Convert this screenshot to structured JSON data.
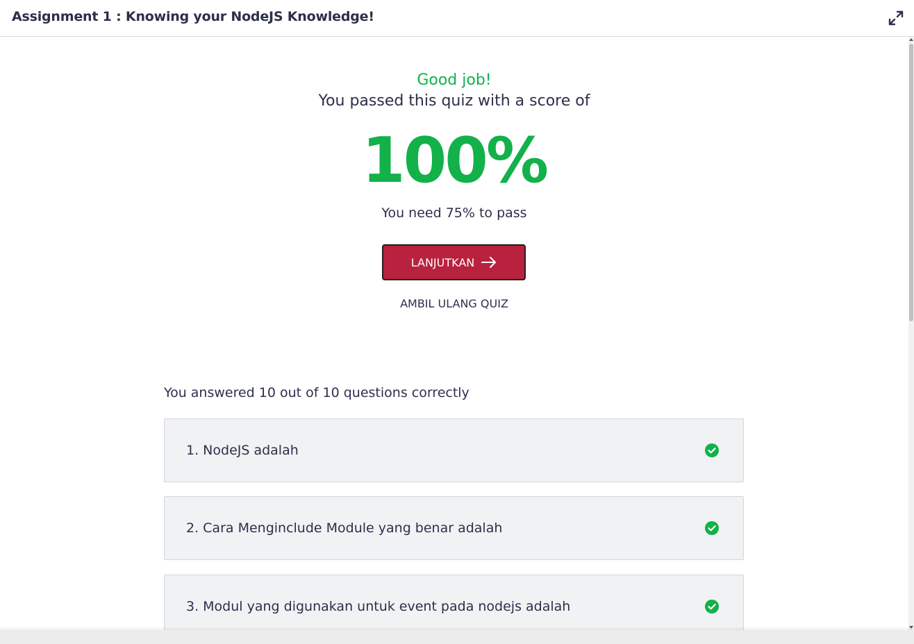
{
  "header": {
    "title": "Assignment 1 : Knowing your NodeJS Knowledge!",
    "expand_icon": "expand-arrows-icon"
  },
  "result": {
    "headline": "Good job!",
    "subheadline": "You passed this quiz with a score of",
    "score": "100%",
    "pass_requirement": "You need 75% to pass",
    "continue_label": "LANJUTKAN",
    "retake_label": "AMBIL ULANG QUIZ",
    "accent_color": "#12b14a",
    "button_color": "#b8223e"
  },
  "summary": {
    "text": "You answered 10 out of 10 questions correctly"
  },
  "questions": [
    {
      "label": "1. NodeJS adalah",
      "status": "correct",
      "icon": "check-circle-icon"
    },
    {
      "label": "2. Cara Menginclude Module yang benar adalah",
      "status": "correct",
      "icon": "check-circle-icon"
    },
    {
      "label": "3. Modul yang digunakan untuk event pada nodejs adalah",
      "status": "correct",
      "icon": "check-circle-icon"
    }
  ]
}
